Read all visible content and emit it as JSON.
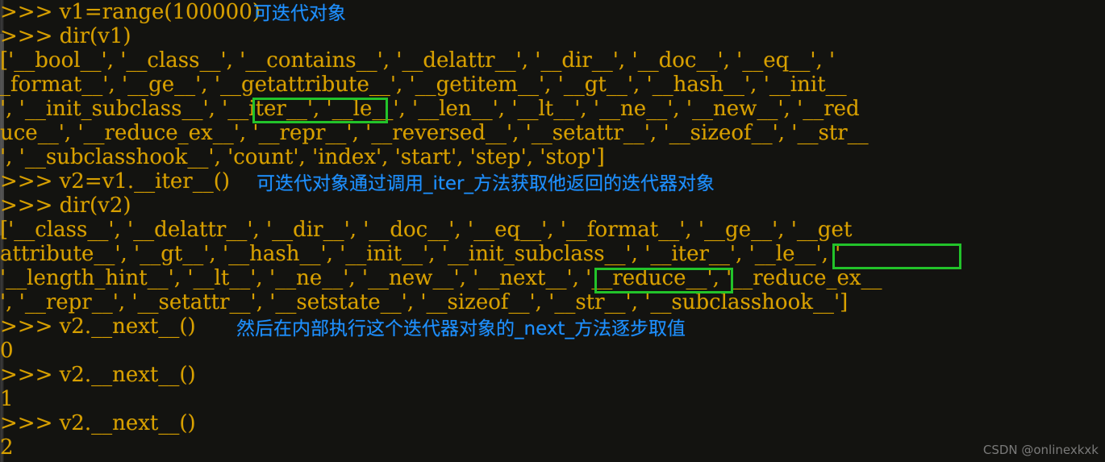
{
  "window": {
    "kind": "python-repl-console",
    "background_color": "#131310",
    "prompt_color": "#d8a000",
    "annotation_color": "#1e90ff",
    "highlight_color": "#22c32a"
  },
  "terminal": {
    "lines": [
      {
        "id": "l1",
        "text": ">>> v1=range(100000)"
      },
      {
        "id": "l2",
        "text": ">>> dir(v1)"
      },
      {
        "id": "l3",
        "text": "['__bool__', '__class__', '__contains__', '__delattr__', '__dir__', '__doc__', '__eq__', '"
      },
      {
        "id": "l4",
        "text": "_format__', '__ge__', '__getattribute__', '__getitem__', '__gt__', '__hash__', '__init__"
      },
      {
        "id": "l5",
        "text": "', '__init_subclass__', '__iter__', '__le__', '__len__', '__lt__', '__ne__', '__new__', '__red"
      },
      {
        "id": "l6",
        "text": "uce__', '__reduce_ex__', '__repr__', '__reversed__', '__setattr__', '__sizeof__', '__str__"
      },
      {
        "id": "l7",
        "text": "', '__subclasshook__', 'count', 'index', 'start', 'step', 'stop']"
      },
      {
        "id": "l8",
        "text": ">>> v2=v1.__iter__()"
      },
      {
        "id": "l9",
        "text": ">>> dir(v2)"
      },
      {
        "id": "l10",
        "text": "['__class__', '__delattr__', '__dir__', '__doc__', '__eq__', '__format__', '__ge__', '__get"
      },
      {
        "id": "l11",
        "text": "attribute__', '__gt__', '__hash__', '__init__', '__init_subclass__', '__iter__', '__le__', '"
      },
      {
        "id": "l12",
        "text": "'__length_hint__', '__lt__', '__ne__', '__new__', '__next__', '__reduce__', '__reduce_ex__"
      },
      {
        "id": "l13",
        "text": "', '__repr__', '__setattr__', '__setstate__', '__sizeof__', '__str__', '__subclasshook__']"
      },
      {
        "id": "l14",
        "text": ">>> v2.__next__()"
      },
      {
        "id": "l15",
        "text": "0"
      },
      {
        "id": "l16",
        "text": ">>> v2.__next__()"
      },
      {
        "id": "l17",
        "text": "1"
      },
      {
        "id": "l18",
        "text": ">>> v2.__next__()"
      },
      {
        "id": "l19",
        "text": "2"
      }
    ]
  },
  "annotations": [
    {
      "id": "a1",
      "text": "可迭代对象"
    },
    {
      "id": "a2",
      "text": "可迭代对象通过调用_iter_方法获取他返回的迭代器对象"
    },
    {
      "id": "a3",
      "text": "然后在内部执行这个迭代器对象的_next_方法逐步取值"
    }
  ],
  "highlights": [
    {
      "id": "h1",
      "label": "'__iter__',"
    },
    {
      "id": "h2",
      "label": "'__iter__',"
    },
    {
      "id": "h3",
      "label": "'__next__',"
    }
  ],
  "watermark": {
    "text": "CSDN @onlinexkxk"
  }
}
